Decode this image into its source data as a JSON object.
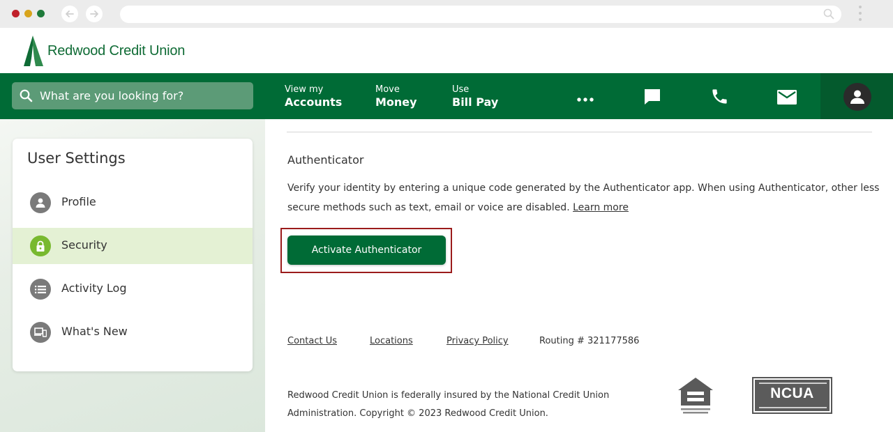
{
  "brand": {
    "name": "Redwood Credit Union",
    "color": "#006b36",
    "accent": "#78b92f"
  },
  "nav": {
    "search_placeholder": "What are you looking for?",
    "links": [
      {
        "small": "View my",
        "big": "Accounts"
      },
      {
        "small": "Move",
        "big": "Money"
      },
      {
        "small": "Use",
        "big": "Bill Pay"
      }
    ],
    "icons": [
      "more-icon",
      "chat-icon",
      "phone-icon",
      "mail-icon",
      "user-icon"
    ]
  },
  "sidebar": {
    "title": "User Settings",
    "items": [
      {
        "label": "Profile",
        "icon": "user-icon",
        "active": false
      },
      {
        "label": "Security",
        "icon": "lock-icon",
        "active": true
      },
      {
        "label": "Activity Log",
        "icon": "list-icon",
        "active": false
      },
      {
        "label": "What's New",
        "icon": "devices-icon",
        "active": false
      }
    ]
  },
  "content": {
    "section_title": "Authenticator",
    "description": "Verify your identity by entering a unique code generated by the Authenticator app. When using Authenticator, other less secure methods such as text, email or voice are disabled.",
    "learn_more": "Learn more",
    "activate_button": "Activate Authenticator"
  },
  "footer": {
    "links": [
      "Contact Us",
      "Locations",
      "Privacy Policy"
    ],
    "routing": "Routing # 321177586",
    "insured_text": "Redwood Credit Union is federally insured by the National Credit Union Administration. Copyright © 2023 Redwood Credit Union.",
    "ncua_logo_text": "NCUA"
  }
}
